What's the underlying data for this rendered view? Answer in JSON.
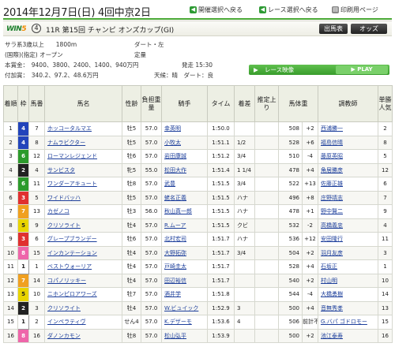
{
  "header": {
    "title": "2014年12月7日(日) 4回中京2日",
    "prev_label": "開催選択へ戻る",
    "back_label": "レース選択へ戻る",
    "print_label": "印刷用ページ"
  },
  "race": {
    "win5_a": "WIN",
    "win5_b": "5",
    "win5_num": "4",
    "name": "11R 第15回 チャンピ オンズカップ(GI)",
    "btn_result": "出馬表",
    "btn_odds": "オッズ",
    "cond1": "サラ系3歳以上　　1800m",
    "cond1b": "ダート・左",
    "cond2": "(国際)(指定) オープン",
    "cond2b": "定量",
    "prize": "本賞金：　9400、3800、2400、1400、940万円",
    "start": "発走 15:30",
    "added": "付加賞：　340.2、97.2、48.6万円",
    "weather": "天候：晴　ダート：良",
    "video_label": "レース映像",
    "play_label": "PLAY"
  },
  "columns": [
    "着順",
    "枠",
    "馬番",
    "馬名",
    "性齢",
    "負担重量",
    "騎手",
    "タイム",
    "着差",
    "推定上り",
    "馬体重",
    "",
    "調教師",
    "単勝人気"
  ],
  "colors": {
    "accent": "#4aa835",
    "link": "#1d3f9b"
  },
  "rows": [
    {
      "rank": "1",
      "waku": "4",
      "wc": "#2244bb",
      "wt": "#fff",
      "num": "7",
      "horse": "ホッコータルマエ",
      "sex": "牡5",
      "wt_load": "57.0",
      "jockey": "幸英明",
      "time": "1:50.0",
      "margin": "",
      "agari": "",
      "bw": "508",
      "bwc": "+2",
      "trainer": "西浦勝一",
      "pop": "2"
    },
    {
      "rank": "2",
      "waku": "4",
      "wc": "#2244bb",
      "wt": "#fff",
      "num": "8",
      "horse": "ナムラビクター",
      "sex": "牡5",
      "wt_load": "57.0",
      "jockey": "小牧太",
      "time": "1:51.1",
      "margin": "1/2",
      "agari": "",
      "bw": "528",
      "bwc": "+6",
      "trainer": "福島信晴",
      "pop": "8"
    },
    {
      "rank": "3",
      "waku": "6",
      "wc": "#2c9a2c",
      "wt": "#fff",
      "num": "12",
      "horse": "ローマンレジェンド",
      "sex": "牡6",
      "wt_load": "57.0",
      "jockey": "岩田康誠",
      "time": "1:51.2",
      "margin": "3/4",
      "agari": "",
      "bw": "510",
      "bwc": "-4",
      "trainer": "藤原英昭",
      "pop": "5"
    },
    {
      "rank": "4",
      "waku": "2",
      "wc": "#222",
      "wt": "#fff",
      "num": "4",
      "horse": "サンビスタ",
      "sex": "牝5",
      "wt_load": "55.0",
      "jockey": "松田大作",
      "time": "1:51.4",
      "margin": "1 1/4",
      "agari": "",
      "bw": "478",
      "bwc": "+4",
      "trainer": "角居勝彦",
      "pop": "12"
    },
    {
      "rank": "5",
      "waku": "6",
      "wc": "#2c9a2c",
      "wt": "#fff",
      "num": "11",
      "horse": "ワンダーアキュート",
      "sex": "牡8",
      "wt_load": "57.0",
      "jockey": "武豊",
      "time": "1:51.5",
      "margin": "3/4",
      "agari": "",
      "bw": "522",
      "bwc": "+13",
      "trainer": "佐藤正雄",
      "pop": "6"
    },
    {
      "rank": "6",
      "waku": "3",
      "wc": "#e03030",
      "wt": "#fff",
      "num": "5",
      "horse": "ワイドバッハ",
      "sex": "牡5",
      "wt_load": "57.0",
      "jockey": "蛯名正義",
      "time": "1:51.5",
      "margin": "ハナ",
      "agari": "",
      "bw": "496",
      "bwc": "+8",
      "trainer": "庄野靖志",
      "pop": "7"
    },
    {
      "rank": "7",
      "waku": "7",
      "wc": "#f0a020",
      "wt": "#fff",
      "num": "13",
      "horse": "カゼノコ",
      "sex": "牡3",
      "wt_load": "56.0",
      "jockey": "秋山真一郎",
      "time": "1:51.5",
      "margin": "ハナ",
      "agari": "",
      "bw": "478",
      "bwc": "+1",
      "trainer": "野中賢二",
      "pop": "9"
    },
    {
      "rank": "8",
      "waku": "5",
      "wc": "#e8d400",
      "wt": "#222",
      "num": "9",
      "horse": "クリソライト",
      "sex": "牡4",
      "wt_load": "57.0",
      "jockey": "R.ムーア",
      "time": "1:51.5",
      "margin": "クビ",
      "agari": "",
      "bw": "532",
      "bwc": "-2",
      "trainer": "高橋義忠",
      "pop": "4"
    },
    {
      "rank": "9",
      "waku": "3",
      "wc": "#e03030",
      "wt": "#fff",
      "num": "6",
      "horse": "グレープブランデー",
      "sex": "牡6",
      "wt_load": "57.0",
      "jockey": "北村宏司",
      "time": "1:51.7",
      "margin": "ハナ",
      "agari": "",
      "bw": "536",
      "bwc": "+12",
      "trainer": "安田隆行",
      "pop": "11"
    },
    {
      "rank": "10",
      "waku": "8",
      "wc": "#ee66aa",
      "wt": "#fff",
      "num": "15",
      "horse": "インカンテーション",
      "sex": "牡4",
      "wt_load": "57.0",
      "jockey": "大野拓弥",
      "time": "1:51.7",
      "margin": "3/4",
      "agari": "",
      "bw": "504",
      "bwc": "+2",
      "trainer": "羽月友彦",
      "pop": "3"
    },
    {
      "rank": "11",
      "waku": "1",
      "wc": "#ffffff",
      "wt": "#222",
      "num": "1",
      "horse": "ベストウォーリア",
      "sex": "牡4",
      "wt_load": "57.0",
      "jockey": "戸崎圭太",
      "time": "1:51.7",
      "margin": "",
      "agari": "",
      "bw": "528",
      "bwc": "+4",
      "trainer": "石坂正",
      "pop": "1"
    },
    {
      "rank": "12",
      "waku": "7",
      "wc": "#f0a020",
      "wt": "#fff",
      "num": "14",
      "horse": "コパノリッキー",
      "sex": "牡4",
      "wt_load": "57.0",
      "jockey": "田辺裕信",
      "time": "1:51.7",
      "margin": "",
      "agari": "",
      "bw": "540",
      "bwc": "+2",
      "trainer": "村山明",
      "pop": "10"
    },
    {
      "rank": "13",
      "waku": "5",
      "wc": "#e8d400",
      "wt": "#222",
      "num": "10",
      "horse": "ニホンピロアワーズ",
      "sex": "牡7",
      "wt_load": "57.0",
      "jockey": "酒井学",
      "time": "1:51.8",
      "margin": "",
      "agari": "",
      "bw": "544",
      "bwc": "-4",
      "trainer": "大橋勇樹",
      "pop": "14"
    },
    {
      "rank": "14",
      "waku": "2",
      "wc": "#222",
      "wt": "#fff",
      "num": "3",
      "horse": "クリソライト",
      "sex": "牡4",
      "wt_load": "57.0",
      "jockey": "W.ビュイック",
      "time": "1:52.9",
      "margin": "3",
      "agari": "",
      "bw": "500",
      "bwc": "+4",
      "trainer": "音無秀孝",
      "pop": "13"
    },
    {
      "rank": "15",
      "waku": "1",
      "wc": "#ffffff",
      "wt": "#222",
      "num": "2",
      "horse": "インペラティヴ",
      "sex": "せん4",
      "wt_load": "57.0",
      "jockey": "K.デザーモ",
      "time": "1:53.6",
      "margin": "4",
      "agari": "",
      "bw": "506",
      "bwc": "前計不",
      "trainer": "G.バパ ゴドロモー",
      "pop": "15"
    },
    {
      "rank": "16",
      "waku": "8",
      "wc": "#ee66aa",
      "wt": "#fff",
      "num": "16",
      "horse": "ダノンカモン",
      "sex": "牡8",
      "wt_load": "57.0",
      "jockey": "松山弘平",
      "time": "1:53.9",
      "margin": "",
      "agari": "",
      "bw": "500",
      "bwc": "+2",
      "trainer": "池江泰寿",
      "pop": "16"
    }
  ]
}
